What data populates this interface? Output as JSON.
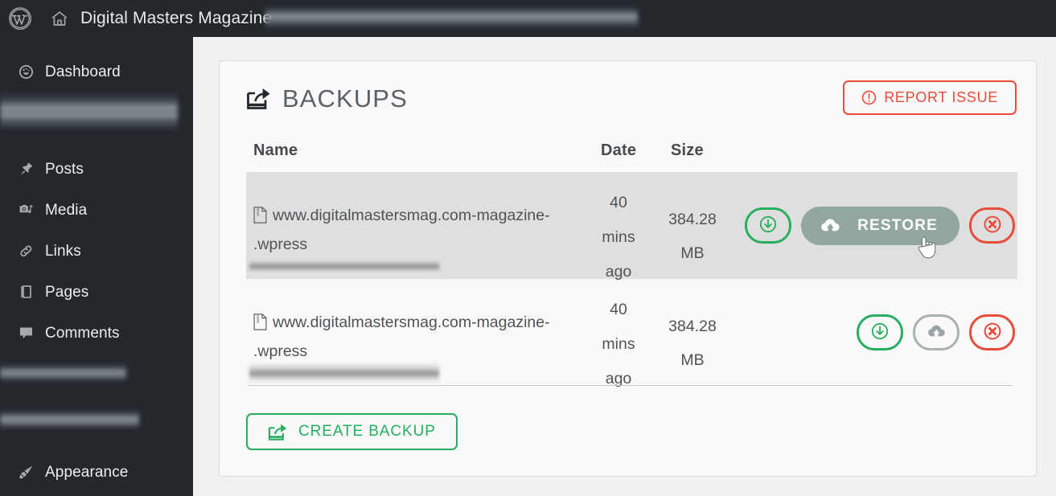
{
  "adminbar": {
    "wp_logo_icon": "wordpress-logo-icon",
    "home_icon": "home-icon",
    "site_title": "Digital Masters Magazine",
    "redacted_item": ""
  },
  "sidebar": {
    "items": [
      {
        "label": "Dashboard",
        "icon": "dashboard-gauge-icon"
      },
      {
        "label": "Posts",
        "icon": "pin-icon"
      },
      {
        "label": "Media",
        "icon": "media-camera-music-icon"
      },
      {
        "label": "Links",
        "icon": "link-chain-icon"
      },
      {
        "label": "Pages",
        "icon": "pages-document-icon"
      },
      {
        "label": "Comments",
        "icon": "comment-bubble-icon"
      },
      {
        "label": "Appearance",
        "icon": "paintbrush-icon"
      }
    ]
  },
  "panel": {
    "title": "BACKUPS",
    "title_icon": "share-export-icon",
    "report_button": {
      "label": "REPORT ISSUE",
      "icon": "exclamation-circle-icon",
      "color": "#e74c3c"
    },
    "create_button": {
      "label": "CREATE BACKUP",
      "icon": "share-export-icon",
      "color": "#27ae60"
    }
  },
  "table": {
    "columns": {
      "name": "Name",
      "date": "Date",
      "size": "Size"
    },
    "rows": [
      {
        "name": "www.digitalmastersmag.com-magazine-",
        "name_suffix": ".wpress",
        "name_icon": "zip-file-icon",
        "date": "40 mins ago",
        "size": "384.28 MB",
        "highlighted": true,
        "actions": {
          "download_label": "",
          "download_icon": "download-circle-icon",
          "restore_label": "RESTORE",
          "restore_icon": "cloud-upload-icon",
          "restore_expanded": true,
          "delete_icon": "close-x-circle-icon"
        }
      },
      {
        "name": "www.digitalmastersmag.com-magazine-",
        "name_suffix": ".wpress",
        "name_icon": "zip-file-icon",
        "date": "40 mins ago",
        "size": "384.28 MB",
        "highlighted": false,
        "actions": {
          "download_label": "",
          "download_icon": "download-circle-icon",
          "restore_label": "",
          "restore_icon": "cloud-upload-icon",
          "restore_expanded": false,
          "delete_icon": "close-x-circle-icon"
        }
      }
    ]
  },
  "cursor": {
    "icon": "pointing-hand-cursor"
  },
  "colors": {
    "admin_dark": "#23282d",
    "green": "#27ae60",
    "red": "#e74c3c",
    "restore_grey": "#93a7a1",
    "row_highlight": "#dfdfdf"
  }
}
